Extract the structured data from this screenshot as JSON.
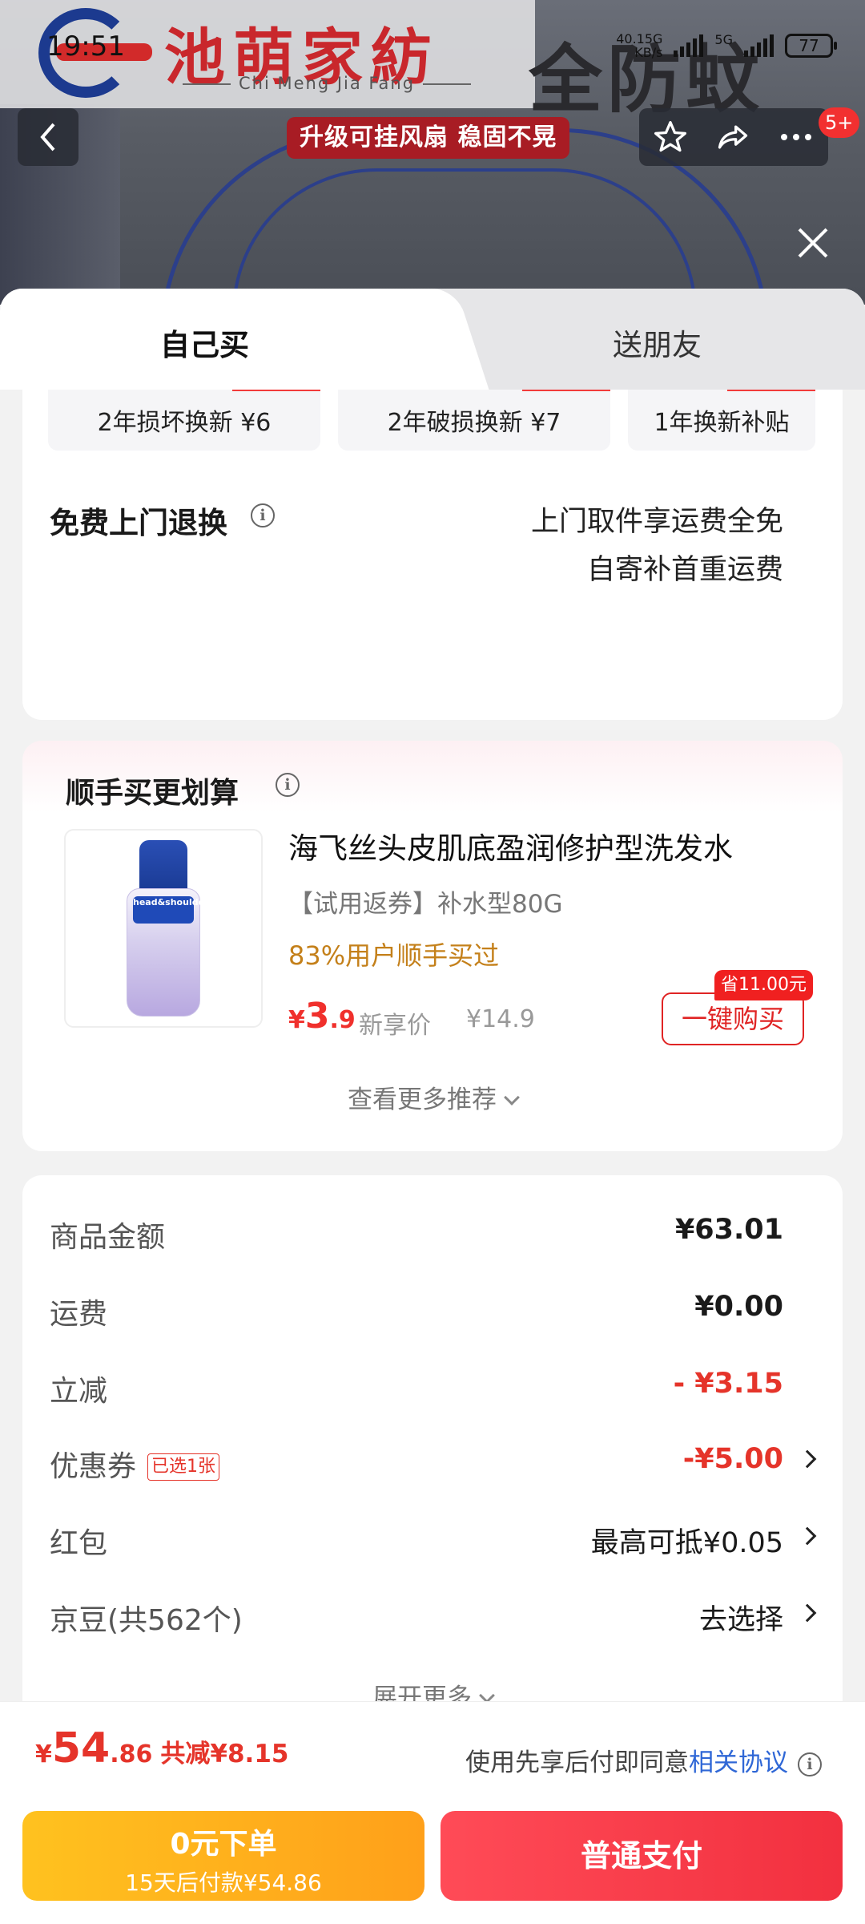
{
  "status_bar": {
    "time": "19:51",
    "net_speed_top": "40.15G",
    "net_speed_bottom": "KB/s",
    "signal_label": "5G",
    "battery": "77"
  },
  "banner": {
    "logo_title": "池萌家紡",
    "logo_subtitle": "Chi Meng Jia Fang",
    "big_text": "全防蚊",
    "promo_pill": "升级可挂风扇 稳固不晃",
    "notification_badge": "5+"
  },
  "tabs": {
    "self": "自己买",
    "friend": "送朋友"
  },
  "service": {
    "chips": [
      "2年损坏换新 ¥6",
      "2年破损换新 ¥7",
      "1年换新补贴"
    ],
    "return_title": "免费上门退换",
    "return_line1": "上门取件享运费全免",
    "return_line2": "自寄补首重运费"
  },
  "addon": {
    "title": "顺手买更划算",
    "product_name": "海飞丝头皮肌底盈润修护型洗发水",
    "product_sub": "【试用返券】补水型80G",
    "social_proof": "83%用户顺手买过",
    "price_symbol": "¥",
    "price_int": "3",
    "price_dec": ".9",
    "price_tag": "新享价",
    "original_price": "¥14.9",
    "save_tag": "省11.00元",
    "buy_button": "一键购买",
    "bottle_label": "head&shoulders",
    "see_more": "查看更多推荐"
  },
  "summary": {
    "rows": [
      {
        "label": "商品金额",
        "value": "¥63.01"
      },
      {
        "label": "运费",
        "value": "¥0.00"
      },
      {
        "label": "立减",
        "value": "- ¥3.15"
      },
      {
        "label": "优惠券",
        "tag": "已选1张",
        "value": "-¥5.00"
      },
      {
        "label": "红包",
        "value": "最高可抵¥0.05"
      },
      {
        "label": "京豆(共562个)",
        "value": "去选择"
      }
    ],
    "expand": "展开更多"
  },
  "bottom_bar": {
    "price_symbol": "¥",
    "price_int": "54",
    "price_dec": ".86",
    "discount": "共减¥8.15",
    "agree_text": "使用先享后付即同意",
    "agree_link": "相关协议",
    "later_line1": "0元下单",
    "later_line2": "15天后付款¥54.86",
    "pay_button": "普通支付"
  },
  "colors": {
    "accent_red": "#e5342a",
    "link_blue": "#2f67d6",
    "gold": "#c4801a",
    "pay_yellow": "#ffb01c",
    "pay_red": "#f2303f"
  }
}
